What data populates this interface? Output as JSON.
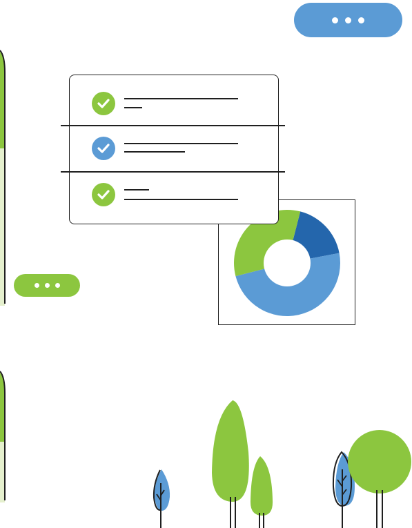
{
  "colors": {
    "green": "#8CC63F",
    "blue": "#5B9BD5",
    "dark_blue": "#2466AC",
    "light_green": "#E5F0CE",
    "outline": "#1f1f1f"
  },
  "checklist": {
    "items": [
      {
        "status": "checked",
        "color": "green"
      },
      {
        "status": "checked",
        "color": "blue"
      },
      {
        "status": "checked",
        "color": "green"
      }
    ]
  },
  "donut_chart": {
    "type": "pie",
    "segments": [
      {
        "color": "#2466AC",
        "fraction": 0.18
      },
      {
        "color": "#5B9BD5",
        "fraction": 0.49
      },
      {
        "color": "#8CC63F",
        "fraction": 0.33
      }
    ]
  },
  "icons": [
    "more-dots-icon",
    "check-icon",
    "tree-icon"
  ]
}
